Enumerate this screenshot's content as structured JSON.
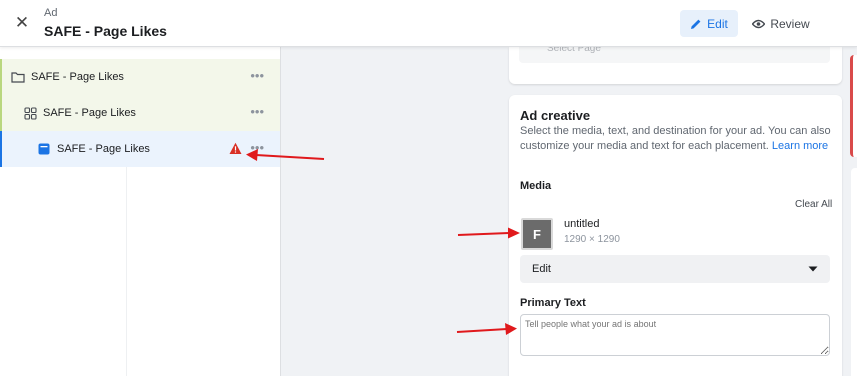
{
  "header": {
    "subtitle": "Ad",
    "title": "SAFE - Page Likes",
    "edit_label": "Edit",
    "review_label": "Review"
  },
  "tree": {
    "campaign_label": "SAFE - Page Likes",
    "adset_label": "SAFE - Page Likes",
    "ad_label": "SAFE - Page Likes",
    "more_glyph": "•••"
  },
  "top_card": {
    "placeholder": "Select Page"
  },
  "creative": {
    "title": "Ad creative",
    "description": "Select the media, text, and destination for your ad. You can also customize your media and text for each placement.",
    "learn_more": "Learn more",
    "media_label": "Media",
    "clear_all": "Clear All",
    "thumb_letter": "F",
    "media_name": "untitled",
    "media_size": "1290 × 1290",
    "edit_select_value": "Edit",
    "primary_text_label": "Primary Text",
    "primary_text_placeholder": "Tell people what your ad is about"
  },
  "colors": {
    "accent": "#1b74e4",
    "warning": "#d93025",
    "annotation": "#e0191c"
  },
  "icons": {
    "close": "close-icon",
    "edit": "pencil-icon",
    "review": "eye-icon",
    "campaign": "folder-icon",
    "adset": "grid-icon",
    "ad": "ad-square-icon",
    "warning": "warning-icon",
    "dropdown": "caret-down-icon"
  }
}
